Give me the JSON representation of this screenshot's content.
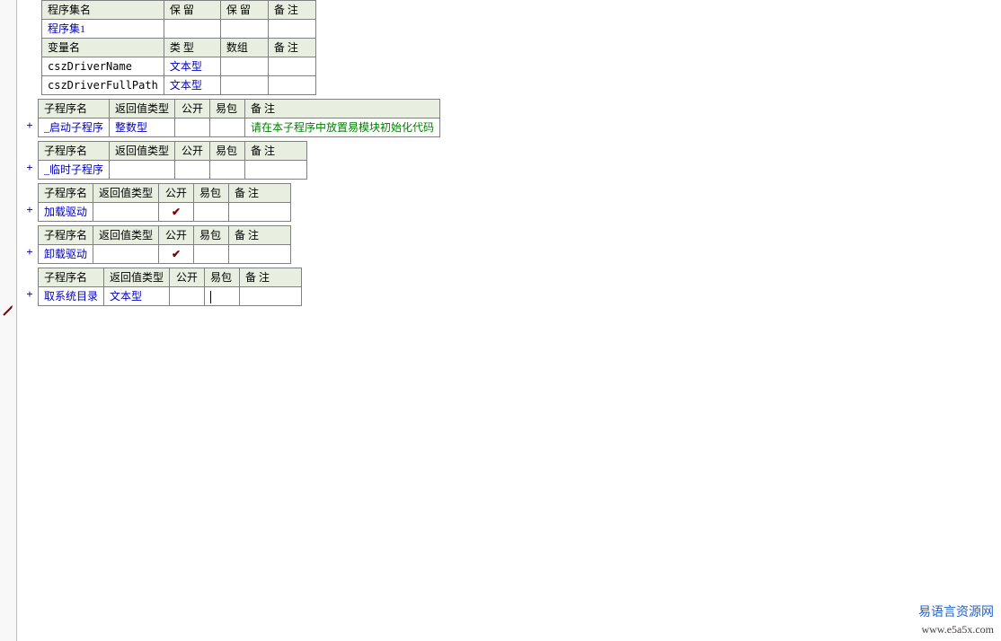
{
  "headers": {
    "program_set": "程序集名",
    "reserve": "保 留",
    "remark": "备 注",
    "var_name": "变量名",
    "type": "类 型",
    "array": "数组",
    "sub_name": "子程序名",
    "return_type": "返回值类型",
    "public": "公开",
    "pkg": "易包"
  },
  "program_set": {
    "name": "程序集1"
  },
  "variables": [
    {
      "name": "cszDriverName",
      "type": "文本型"
    },
    {
      "name": "cszDriverFullPath",
      "type": "文本型"
    }
  ],
  "subs": [
    {
      "name": "_启动子程序",
      "return_type": "整数型",
      "public": false,
      "remark": "请在本子程序中放置易模块初始化代码"
    },
    {
      "name": "_临时子程序",
      "return_type": "",
      "public": false,
      "remark": ""
    },
    {
      "name": "加载驱动",
      "return_type": "",
      "public": true,
      "remark": ""
    },
    {
      "name": "卸载驱动",
      "return_type": "",
      "public": true,
      "remark": ""
    },
    {
      "name": "取系统目录",
      "return_type": "文本型",
      "public": false,
      "remark": "",
      "editing": true
    }
  ],
  "icons": {
    "check": "✔",
    "plus": "+"
  },
  "watermark": {
    "title": "易语言资源网",
    "url": "www.e5a5x.com"
  }
}
